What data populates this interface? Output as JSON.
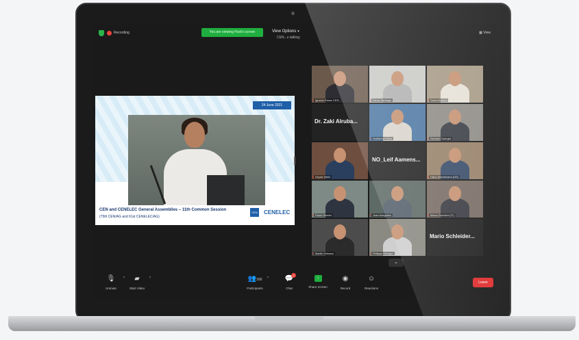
{
  "topbar": {
    "recording_label": "Recording",
    "share_banner": "You are viewing Host's screen",
    "view_options": "View Options",
    "sub_line": "CEN...s talking:",
    "view_btn": "View"
  },
  "slide": {
    "date": "24 June 2021",
    "title": "CEN and CENELEC General Assemblies – 11th Common Session",
    "subtitle": "(75th CEN/AG and 61st CENELEC/AG)",
    "logo_left": "CEN",
    "logo_right": "CENELEC"
  },
  "gallery": {
    "tiles": [
      {
        "name": "Ignacio Elewe CEN",
        "kind": "video"
      },
      {
        "name": "Elena Santiago",
        "kind": "video"
      },
      {
        "name": "Saud Alzahmi",
        "kind": "video"
      },
      {
        "name": "Dr. Zaki Alruba...",
        "kind": "text"
      },
      {
        "name": "Guillaume Hess",
        "kind": "video"
      },
      {
        "name": "Gerhard Guergel",
        "kind": "video"
      },
      {
        "name": "Seyda Weikl",
        "kind": "video"
      },
      {
        "name": "NO_Leif Aamens...",
        "kind": "text"
      },
      {
        "name": "Hans Wiedemann (DE)",
        "kind": "video"
      },
      {
        "name": "Paulo Ribeiro",
        "kind": "video"
      },
      {
        "name": "Juan Aceguirre",
        "kind": "video"
      },
      {
        "name": "Marco Bocchini (IT)",
        "kind": "video"
      },
      {
        "name": "Martin Geibach",
        "kind": "video"
      },
      {
        "name": "Philippe Metzger",
        "kind": "video"
      },
      {
        "name": "Mario Schleider...",
        "kind": "text"
      }
    ]
  },
  "toolbar": {
    "unmute": "Unmute",
    "start_video": "Start Video",
    "participants": "Participants",
    "participants_count": "160",
    "chat": "Chat",
    "chat_badge": "2",
    "share_screen": "Share Screen",
    "record": "Record",
    "reactions": "Reactions",
    "leave": "Leave"
  },
  "colors": {
    "share_green": "#1fae3f",
    "leave_red": "#e02d2d",
    "cen_blue": "#1f5fa8"
  }
}
